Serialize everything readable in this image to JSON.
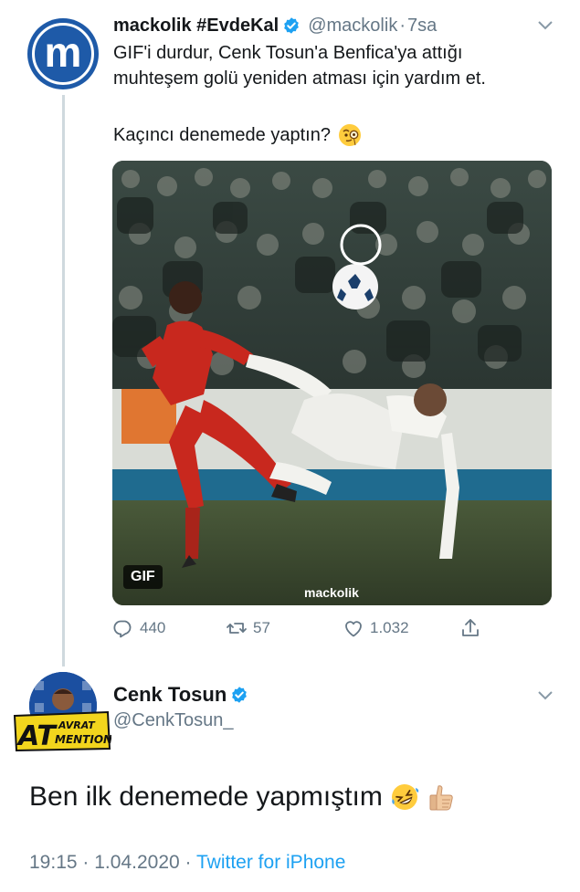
{
  "tweet": {
    "author_name": "mackolik #EvdeKal",
    "handle": "@mackolik",
    "separator": "·",
    "time": "7sa",
    "avatar_letter": "m",
    "text_lines": [
      "GIF'i durdur, Cenk Tosun'a Benfica'ya attığı",
      "muhteşem golü yeniden atması için yardım et."
    ],
    "question": "Kaçıncı denemede yaptın?",
    "question_emoji": "monocle-face-emoji",
    "media": {
      "badge": "GIF",
      "watermark": "mackolik"
    },
    "actions": {
      "replies": "440",
      "retweets": "57",
      "likes": "1.032"
    }
  },
  "reply": {
    "author_name": "Cenk Tosun",
    "handle": "@CenkTosun_",
    "badge_text_big": "AT",
    "badge_text_top": "AVRAT",
    "badge_text_bottom": "MENTION",
    "text": "Ben ilk denemede yapmıştım",
    "emojis": [
      "rolling-on-floor-laughing-emoji",
      "thumbs-up-emoji"
    ],
    "time": "19:15",
    "date": "1.04.2020",
    "separator": "·",
    "source": "Twitter for iPhone"
  },
  "colors": {
    "brand_blue": "#1e5aa8",
    "verified_blue": "#1da1f2",
    "muted": "#657786",
    "text": "#14171a"
  }
}
